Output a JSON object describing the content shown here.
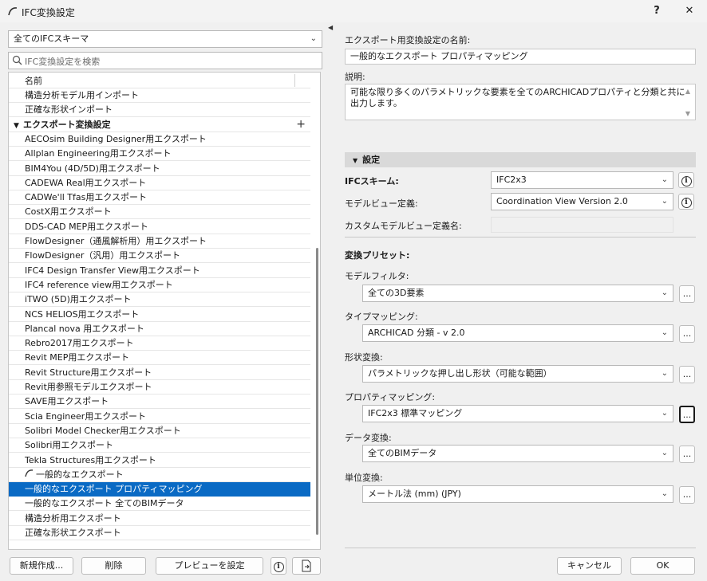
{
  "window": {
    "title": "IFC変換設定",
    "help": "?",
    "close": "✕"
  },
  "left": {
    "schema_filter": "全てのIFCスキーマ",
    "search_placeholder": "IFC変換設定を検索",
    "list_header": "名前",
    "rows": [
      {
        "label": "構造分析モデル用インポート",
        "type": "item"
      },
      {
        "label": "正確な形状インポート",
        "type": "item"
      },
      {
        "label": "エクスポート変換設定",
        "type": "group"
      },
      {
        "label": "AECOsim Building Designer用エクスポート",
        "type": "item"
      },
      {
        "label": "Allplan Engineering用エクスポート",
        "type": "item"
      },
      {
        "label": "BIM4You (4D/5D)用エクスポート",
        "type": "item"
      },
      {
        "label": "CADEWA Real用エクスポート",
        "type": "item"
      },
      {
        "label": "CADWe'll Tfas用エクスポート",
        "type": "item"
      },
      {
        "label": "CostX用エクスポート",
        "type": "item"
      },
      {
        "label": "DDS-CAD MEP用エクスポート",
        "type": "item"
      },
      {
        "label": "FlowDesigner（通風解析用）用エクスポート",
        "type": "item"
      },
      {
        "label": "FlowDesigner（汎用）用エクスポート",
        "type": "item"
      },
      {
        "label": "IFC4 Design Transfer View用エクスポート",
        "type": "item"
      },
      {
        "label": "IFC4 reference view用エクスポート",
        "type": "item"
      },
      {
        "label": "iTWO (5D)用エクスポート",
        "type": "item"
      },
      {
        "label": "NCS HELIOS用エクスポート",
        "type": "item"
      },
      {
        "label": "Plancal nova 用エクスポート",
        "type": "item"
      },
      {
        "label": "Rebro2017用エクスポート",
        "type": "item"
      },
      {
        "label": "Revit MEP用エクスポート",
        "type": "item"
      },
      {
        "label": "Revit Structure用エクスポート",
        "type": "item"
      },
      {
        "label": "Revit用参照モデルエクスポート",
        "type": "item"
      },
      {
        "label": "SAVE用エクスポート",
        "type": "item"
      },
      {
        "label": "Scia Engineer用エクスポート",
        "type": "item"
      },
      {
        "label": "Solibri Model Checker用エクスポート",
        "type": "item"
      },
      {
        "label": "Solibri用エクスポート",
        "type": "item"
      },
      {
        "label": "Tekla Structures用エクスポート",
        "type": "item"
      },
      {
        "label": "一般的なエクスポート",
        "type": "icon-item"
      },
      {
        "label": "一般的なエクスポート プロパティマッピング",
        "type": "selected"
      },
      {
        "label": "一般的なエクスポート 全てのBIMデータ",
        "type": "item"
      },
      {
        "label": "構造分析用エクスポート",
        "type": "item"
      },
      {
        "label": "正確な形状エクスポート",
        "type": "item"
      }
    ],
    "buttons": {
      "new": "新規作成...",
      "delete": "削除",
      "preview": "プレビューを設定"
    }
  },
  "right": {
    "name_label": "エクスポート用変換設定の名前:",
    "name_value": "一般的なエクスポート プロパティマッピング",
    "desc_label": "説明:",
    "desc_value": "可能な限り多くのパラメトリックな要素を全てのARCHICADプロパティと分類と共に出力します。",
    "settings_header": "設定",
    "ifc_scheme_label": "IFCスキーム:",
    "ifc_scheme_value": "IFC2x3",
    "mvd_label": "モデルビュー定義:",
    "mvd_value": "Coordination View Version 2.0",
    "custom_mvd_label": "カスタムモデルビュー定義名:",
    "presets_label": "変換プリセット:",
    "model_filter_label": "モデルフィルタ:",
    "model_filter_value": "全ての3D要素",
    "type_mapping_label": "タイプマッピング:",
    "type_mapping_value": "ARCHICAD 分類 - v 2.0",
    "geometry_label": "形状変換:",
    "geometry_value": "パラメトリックな押し出し形状（可能な範囲）",
    "property_mapping_label": "プロパティマッピング:",
    "property_mapping_value": "IFC2x3 標準マッピング",
    "data_conv_label": "データ変換:",
    "data_conv_value": "全てのBIMデータ",
    "unit_conv_label": "単位変換:",
    "unit_conv_value": "メートル法 (mm) (JPY)",
    "ellipsis": "...",
    "cancel": "キャンセル",
    "ok": "OK"
  }
}
